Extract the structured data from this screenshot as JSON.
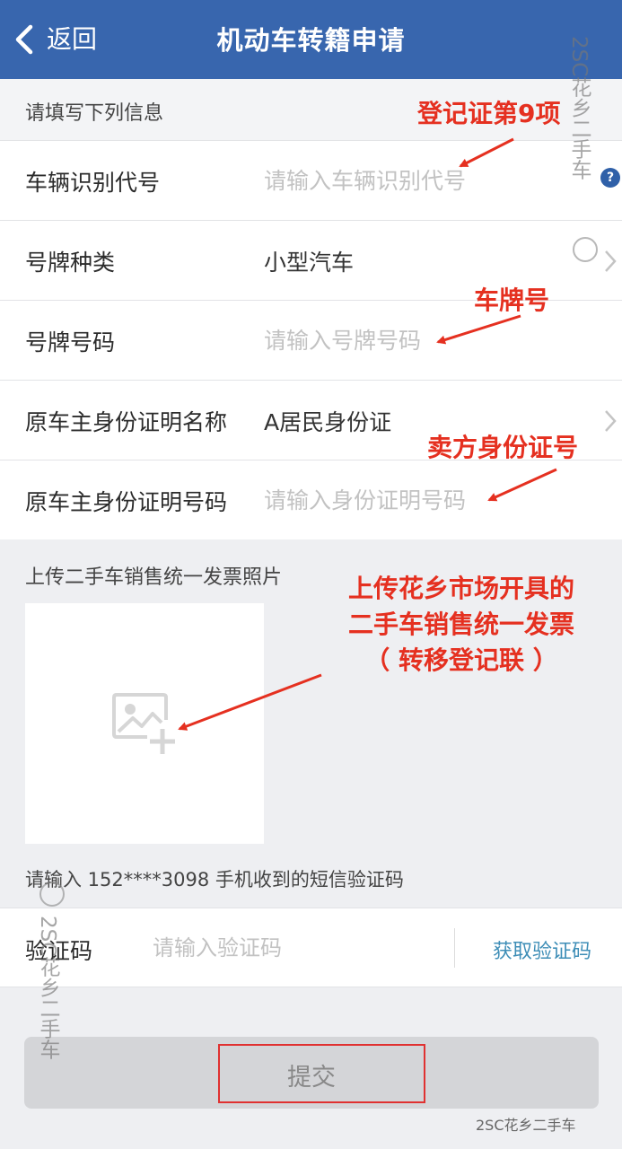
{
  "navbar": {
    "back_label": "返回",
    "title": "机动车转籍申请"
  },
  "form": {
    "section_header": "请填写下列信息",
    "rows": [
      {
        "label": "车辆识别代号",
        "placeholder": "请输入车辆识别代号"
      },
      {
        "label": "号牌种类",
        "value": "小型汽车"
      },
      {
        "label": "号牌号码",
        "placeholder": "请输入号牌号码"
      },
      {
        "label": "原车主身份证明名称",
        "value": "A居民身份证"
      },
      {
        "label": "原车主身份证明号码",
        "placeholder": "请输入身份证明号码"
      }
    ]
  },
  "upload": {
    "label": "上传二手车销售统一发票照片"
  },
  "sms": {
    "hint": "请输入 152****3098 手机收到的短信验证码",
    "code_label": "验证码",
    "code_placeholder": "请输入验证码",
    "get_code_label": "获取验证码"
  },
  "submit": {
    "label": "提交"
  },
  "annotations": {
    "vin": "登记证第9项",
    "plate": "车牌号",
    "seller_id": "卖方身份证号",
    "invoice_line1": "上传花乡市场开具的",
    "invoice_line2": "二手车销售统一发票",
    "invoice_line3": "（ 转移登记联 ）"
  },
  "watermarks": {
    "vertical": "2SC花乡二手车",
    "bottom": "2SC花乡二手车"
  },
  "colors": {
    "navbar": "#3866ae",
    "annotation": "#e53020",
    "link": "#3e8eb7"
  }
}
